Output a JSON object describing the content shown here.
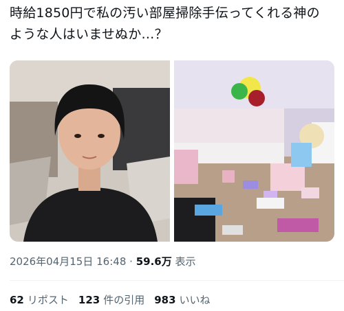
{
  "tweet": {
    "text": "時給1850円で私の汚い部屋掃除手伝ってくれる神のような人はいませぬか…？"
  },
  "media": {
    "photos": [
      "selfie-photo",
      "messy-room-photo"
    ]
  },
  "meta": {
    "date": "2026年04月15日",
    "time": "16:48",
    "separator": "·",
    "views_count": "59.6万",
    "views_label": "表示"
  },
  "stats": {
    "reposts_count": "62",
    "reposts_label": "リポスト",
    "quotes_count": "123",
    "quotes_label": "件の引用",
    "likes_count": "983",
    "likes_label": "いいね"
  }
}
